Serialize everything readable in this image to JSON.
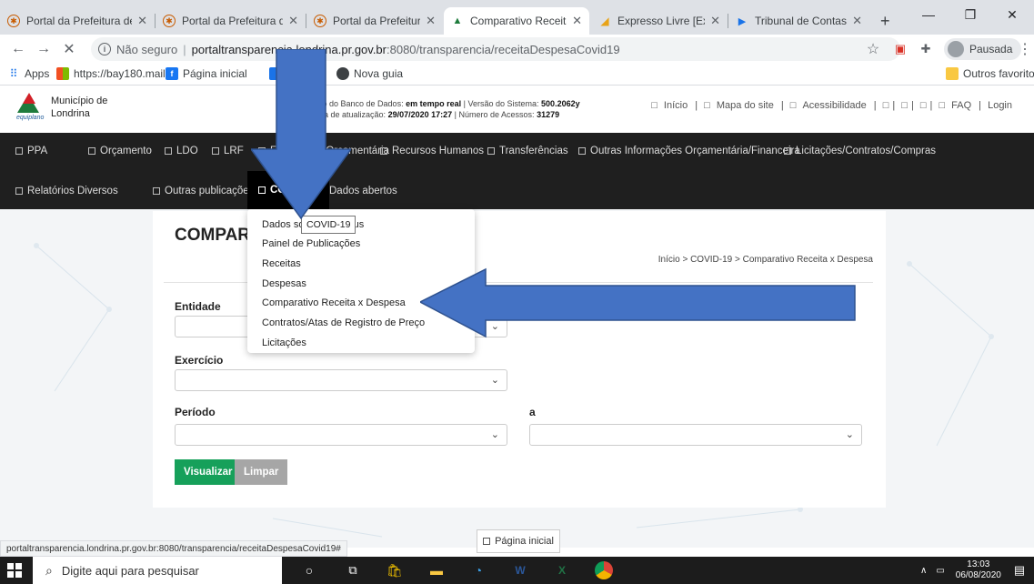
{
  "browser": {
    "tabs": [
      {
        "title": "Portal da Prefeitura de L",
        "active": false
      },
      {
        "title": "Portal da Prefeitura de L",
        "active": false
      },
      {
        "title": "Portal da Prefeitura de L",
        "active": false
      },
      {
        "title": "Comparativo Receita x",
        "active": true
      },
      {
        "title": "Expresso Livre [Expresso",
        "active": false
      },
      {
        "title": "Tribunal de Contas do E",
        "active": false
      }
    ],
    "new_tab": "+",
    "security_label": "Não seguro",
    "url_host": "portaltransparencia.londrina.pr.gov.br",
    "url_path": ":8080/transparencia/receitaDespesaCovid19",
    "profile_label": "Pausada",
    "bookmarks": {
      "apps": "Apps",
      "mail": "https://bay180.mail....",
      "facebook": "Página inicial",
      "hidden": "inicial",
      "newtab": "Nova guia",
      "other": "Outros favoritos"
    }
  },
  "site": {
    "org_line1": "Município de",
    "org_line2": "Londrina",
    "logo_caption": "equiplano",
    "db_line1_prefix": "rsão do Banco de Dados:",
    "db_realtime": "em tempo real",
    "db_version_label": "| Versão do Sistema:",
    "db_version": "500.2062y",
    "db_line2_prefix": "Data de atualização:",
    "db_updated": "29/07/2020 17:27",
    "db_access_label": "| Número de Acessos:",
    "db_access": "31279",
    "top_links": [
      "Início",
      "Mapa do site",
      "Acessibilidade",
      "",
      "",
      "",
      "FAQ"
    ],
    "login": "Login"
  },
  "nav": {
    "row1": [
      "PPA",
      "Orçamento",
      "LDO",
      "LRF",
      "Exec",
      "ção Orçamentária",
      "Recursos Humanos",
      "Transferências",
      "Outras Informações Orçamentária/Financeira",
      "Licitações/Contratos/Compras"
    ],
    "row2": [
      "Relatórios Diversos",
      "Outras publicações",
      "COVID-19",
      "Dados abertos"
    ]
  },
  "dropdown": {
    "items": [
      "Dados so",
      "irus",
      "Painel de Publicações",
      "Receitas",
      "Despesas",
      "Comparativo Receita x Despesa",
      "Contratos/Atas de Registro de Preço",
      "Licitações"
    ],
    "tooltip": "COVID-19"
  },
  "page": {
    "title": "COMPARATI",
    "breadcrumb": "Início > COVID-19 > Comparativo Receita x Despesa",
    "fields": {
      "entidade": "Entidade",
      "exercicio": "Exercício",
      "periodo": "Período",
      "a": "a"
    },
    "buttons": {
      "visualizar": "Visualizar",
      "limpar": "Limpar"
    },
    "home_button": "Página inicial"
  },
  "status_url": "portaltransparencia.londrina.pr.gov.br:8080/transparencia/receitaDespesaCovid19#",
  "taskbar": {
    "search_placeholder": "Digite aqui para pesquisar",
    "time": "13:03",
    "date": "06/08/2020"
  },
  "colors": {
    "nav_bg": "#1f1f1f",
    "accent_green": "#16a05a",
    "arrow_blue": "#4472c4"
  }
}
